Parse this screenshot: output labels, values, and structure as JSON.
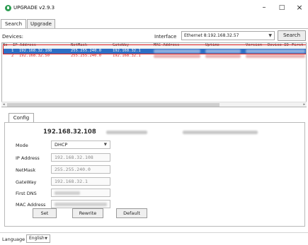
{
  "window": {
    "title": "UPGRADE v2.9.3",
    "minimize_glyph": "–",
    "maximize_glyph": "□",
    "close_glyph": "×"
  },
  "tabs": [
    {
      "label": "Search",
      "active": true
    },
    {
      "label": "Upgrade",
      "active": false
    }
  ],
  "toolbar": {
    "devices_label": "Devices:",
    "interface_label": "Interface",
    "interface_value": "Ethernet 8:192.168.32.57",
    "search_label": "Search"
  },
  "grid": {
    "columns": [
      "No",
      "IP Address",
      "NetMask",
      "GateWay",
      "MAC Address",
      "Uptime",
      "Version",
      "Device ID",
      "First"
    ],
    "rows": [
      {
        "no": "1",
        "ip": "192.168.32.108",
        "netmask": "255.255.240.0",
        "gateway": "192.168.32.1",
        "selected": true
      },
      {
        "no": "2",
        "ip": "192.168.32.50",
        "netmask": "255.255.240.0",
        "gateway": "192.168.32.1",
        "selected": false
      }
    ]
  },
  "config": {
    "tab_label": "Config",
    "ip_title": "192.168.32.108",
    "mode_label": "Mode",
    "mode_value": "DHCP",
    "ip_label": "IP Address",
    "ip_value": "192.168.32.108",
    "netmask_label": "NetMask",
    "netmask_value": "255.255.240.0",
    "gateway_label": "GateWay",
    "gateway_value": "192.168.32.1",
    "dns_label": "First DNS",
    "mac_label": "MAC Address",
    "set_label": "Set",
    "rewrite_label": "Rewrite",
    "default_label": "Default"
  },
  "footer": {
    "language_label": "Language",
    "language_value": "English"
  },
  "colors": {
    "selection": "#2d6fc5",
    "highlight_border": "#e02020",
    "app_icon": "#2e9d52"
  },
  "icons": {
    "app": "app-logo-icon",
    "dropdown": "chevron-down-icon"
  }
}
